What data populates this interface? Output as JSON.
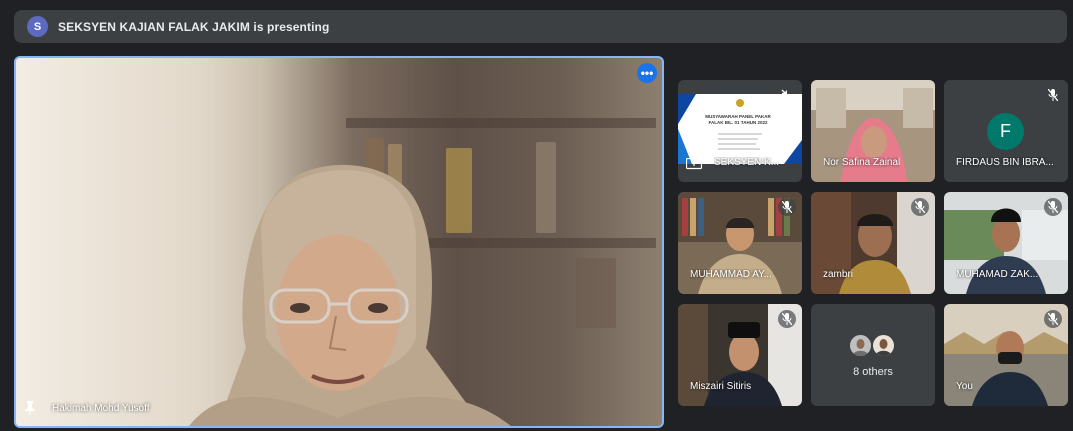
{
  "banner": {
    "avatar_letter": "S",
    "text": "SEKSYEN KAJIAN FALAK JAKIM is presenting"
  },
  "main": {
    "participant_name": "Hakimah Mohd Yusoff",
    "more_icon": "more-horizontal-icon",
    "pin_icon": "pin-icon",
    "highlight_color": "#8ab4f8"
  },
  "grid": {
    "tiles": [
      {
        "name": "SEKSYEN K...",
        "type": "presentation",
        "slide_title": "MUSYAWARAH PANEL PAKAR FALAK BIL. 01 TAHUN 2022",
        "icon": "present-screen-icon",
        "muted_icon": "volume-off-icon"
      },
      {
        "name": "Nor Safina Zainal",
        "type": "video"
      },
      {
        "name": "FIRDAUS BIN IBRA...",
        "type": "avatar",
        "avatar_letter": "F",
        "avatar_color": "#00796b",
        "muted_icon": "mic-off-icon"
      },
      {
        "name": "MUHAMMAD AY...",
        "type": "video",
        "muted_icon": "mic-off-icon"
      },
      {
        "name": "zambri",
        "type": "video",
        "muted_icon": "mic-off-icon"
      },
      {
        "name": "MUHAMAD ZAK...",
        "type": "video",
        "muted_icon": "mic-off-icon"
      },
      {
        "name": "Miszairi Sitiris",
        "type": "video",
        "muted_icon": "mic-off-icon"
      },
      {
        "name": "8 others",
        "type": "others"
      },
      {
        "name": "You",
        "type": "video",
        "muted_icon": "mic-off-icon"
      }
    ]
  },
  "colors": {
    "background": "#202124",
    "banner": "#3c4043",
    "tile": "#3c4043",
    "accent": "#1a73e8"
  }
}
